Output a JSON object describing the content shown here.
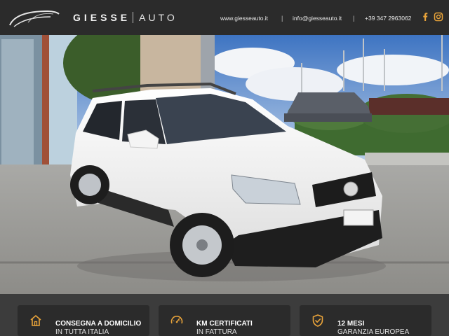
{
  "header": {
    "logo_icon": "car-swoosh-logo",
    "brand_left": "GIESSE",
    "brand_right": "AUTO",
    "website": "www.giesseauto.it",
    "email": "info@giesseauto.it",
    "phone": "+39 347 2963062",
    "separator": "|",
    "social": [
      {
        "name": "facebook-icon",
        "color": "#e8a33a"
      },
      {
        "name": "instagram-icon",
        "color": "#e8a33a"
      }
    ]
  },
  "photo": {
    "subject": "white-nissan-qashqai"
  },
  "features": [
    {
      "icon": "home-icon",
      "title": "CONSEGNA A DOMICILIO",
      "subtitle": "IN TUTTA ITALIA"
    },
    {
      "icon": "speedometer-icon",
      "title": "KM CERTIFICATI",
      "subtitle": "IN FATTURA"
    },
    {
      "icon": "shield-check-icon",
      "title": "12 MESI",
      "subtitle": "GARANZIA EUROPEA"
    }
  ],
  "colors": {
    "header_bg": "#2b2b2b",
    "accent": "#e8a33a",
    "card_bg": "#2b2b2b"
  }
}
